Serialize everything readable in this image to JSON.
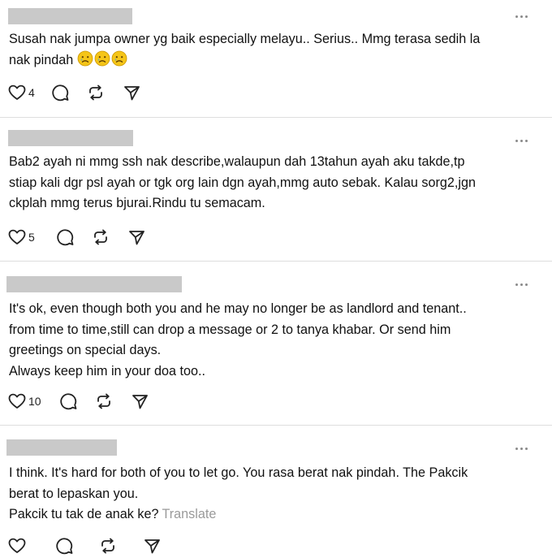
{
  "posts": [
    {
      "text": "Susah nak jumpa owner yg baik especially melayu.. Serius.. Mmg terasa sedih la\nnak pindah",
      "emojis": [
        "crying-face",
        "crying-face",
        "crying-face"
      ],
      "likes": "4"
    },
    {
      "text": "Bab2 ayah ni mmg ssh nak describe,walaupun dah 13tahun ayah aku takde,tp\nstiap kali dgr psl ayah or tgk org lain dgn ayah,mmg auto sebak. Kalau sorg2,jgn\nckplah mmg terus bjurai.Rindu tu semacam.",
      "likes": "5"
    },
    {
      "text": "It's ok, even though both you and he may no longer be as landlord and tenant..\nfrom time to time,still can drop a message or 2 to tanya khabar. Or send him\ngreetings on special days.\nAlways keep him in your doa too..",
      "likes": "10"
    },
    {
      "text": "I think. It's hard for both of you to let go. You rasa berat nak pindah. The Pakcik\nberat to lepaskan you.\nPakcik tu tak de anak ke?",
      "translate": "Translate",
      "likes": ""
    }
  ],
  "icons": {
    "like": "heart-icon",
    "reply": "comment-icon",
    "repost": "repost-icon",
    "share": "send-icon",
    "more": "more-icon"
  }
}
